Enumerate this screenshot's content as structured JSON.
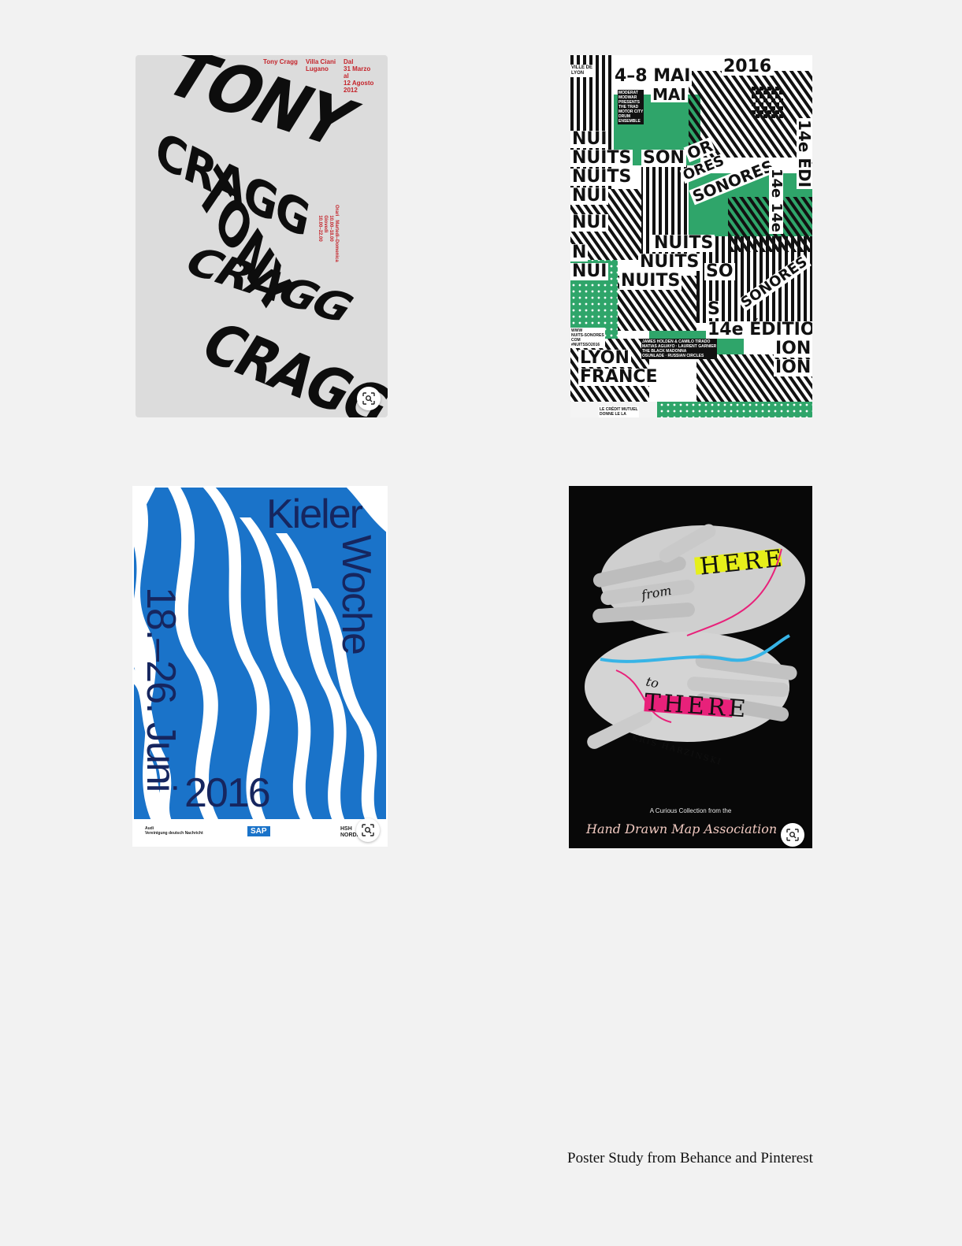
{
  "posters": [
    {
      "header": {
        "artist": "Tony Cragg",
        "venue": "Villa Ciani\nLugano",
        "dates": "Dal\n31 Marzo\nal\n12 Agosto\n2012"
      },
      "side_info": "Orari   Martedì–Domenica\n        10.00–18.00\n        Giovedì\n        10.00–22.00",
      "wave_words": [
        "TONY",
        "CRAGG",
        "TONY",
        "CRAGG",
        "CRAGG"
      ]
    },
    {
      "top": {
        "city_badge": "VILLE DE\nLYON",
        "dates": "4–8 MAI",
        "year": "2016"
      },
      "words": {
        "mai": "MAI",
        "nui": "NUI",
        "nuits": "NUITS",
        "son": "SON",
        "sonores": "SONORES",
        "or": "OR",
        "ores": "ORES",
        "edition_side": "14e ÉDI",
        "edition_side_2": "14e 14e",
        "edition": "14e ÉDITIO",
        "ion": "ION",
        "n": "N",
        "s": "S",
        "so": "SO",
        "lyon": "LYON",
        "france": "FRANCE"
      },
      "lineup_small": "MODERAT\nMODWAR\nPRESENTS\nTHE TRAD\nMOTOR CITY\nDRUM\nENSEMBLE",
      "website": "WWW\nNUITS-SONORES\nCOM\n#NUITSSO2016",
      "lineup_bottom": "JAMES HOLDEN & CAMILO TIRADO\nMATIAS AGUAYO · LAURENT GARNIER\nTHE BLACK MADONNA\nOSUNLADE · RUSSIAN CIRCLES",
      "footer_badge": "LE CRÉDIT MUTUEL\nDONNE LE LA",
      "colors": {
        "green": "#2fa56a",
        "black": "#111111",
        "white": "#ffffff"
      }
    },
    {
      "title_1": "Kieler",
      "title_2": "Woche",
      "dates": "18.–26. Juni",
      "year": "2016",
      "sponsors": [
        "Audi\nVereinigung deutsch Nachricht",
        "SAP",
        "HSH\nNORDBANK"
      ],
      "colors": {
        "blue": "#1a73c9",
        "navy": "#16265f"
      }
    },
    {
      "from": "from",
      "here": "HERE",
      "to": "to",
      "there": "THERE",
      "author": "KRIS HARZINSKI",
      "subtitle": "A Curious Collection from the",
      "association": "Hand Drawn Map Association",
      "colors": {
        "yellow": "#e6ef1a",
        "pink": "#e8217a",
        "cyan": "#37b4e6"
      }
    }
  ],
  "lens_icon": "visual-search-icon",
  "caption": "Poster Study from Behance and Pinterest"
}
